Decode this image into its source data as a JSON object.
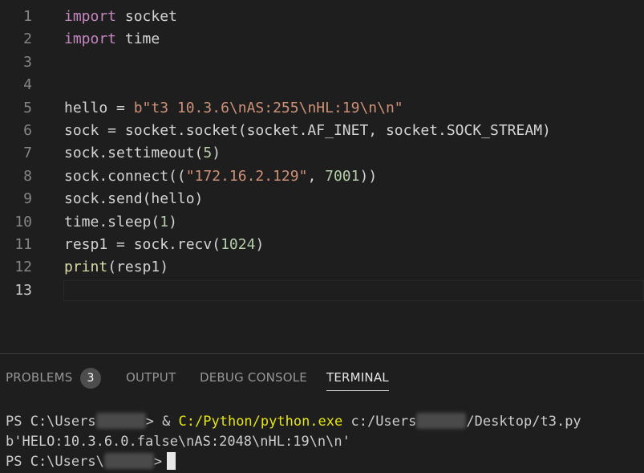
{
  "editor": {
    "line_numbers": [
      "1",
      "2",
      "3",
      "4",
      "5",
      "6",
      "7",
      "8",
      "9",
      "10",
      "11",
      "12",
      "13"
    ],
    "lines": [
      [
        {
          "t": "import",
          "c": "kw"
        },
        {
          "t": " socket",
          "c": "plain"
        }
      ],
      [
        {
          "t": "import",
          "c": "kw"
        },
        {
          "t": " time",
          "c": "plain"
        }
      ],
      [],
      [],
      [
        {
          "t": "hello = ",
          "c": "plain"
        },
        {
          "t": "b\"t3 10.3.6\\nAS:255\\nHL:19\\n\\n\"",
          "c": "str"
        }
      ],
      [
        {
          "t": "sock = socket.socket(socket.AF_INET, socket.SOCK_STREAM)",
          "c": "plain"
        }
      ],
      [
        {
          "t": "sock.settimeout(",
          "c": "plain"
        },
        {
          "t": "5",
          "c": "num"
        },
        {
          "t": ")",
          "c": "plain"
        }
      ],
      [
        {
          "t": "sock.connect((",
          "c": "plain"
        },
        {
          "t": "\"172.16.2.129\"",
          "c": "str"
        },
        {
          "t": ", ",
          "c": "plain"
        },
        {
          "t": "7001",
          "c": "num"
        },
        {
          "t": "))",
          "c": "plain"
        }
      ],
      [
        {
          "t": "sock.send(hello)",
          "c": "plain"
        }
      ],
      [
        {
          "t": "time.sleep(",
          "c": "plain"
        },
        {
          "t": "1",
          "c": "num"
        },
        {
          "t": ")",
          "c": "plain"
        }
      ],
      [
        {
          "t": "resp1 = sock.recv(",
          "c": "plain"
        },
        {
          "t": "1024",
          "c": "num"
        },
        {
          "t": ")",
          "c": "plain"
        }
      ],
      [
        {
          "t": "print",
          "c": "fn"
        },
        {
          "t": "(resp1)",
          "c": "plain"
        }
      ],
      []
    ]
  },
  "panel": {
    "tabs": {
      "problems": "PROBLEMS",
      "problems_count": "3",
      "output": "OUTPUT",
      "debug_console": "DEBUG CONSOLE",
      "terminal": "TERMINAL"
    },
    "terminal": {
      "line1_prompt": "PS C:\\Users",
      "line1_arrow": "> & ",
      "line1_exe": "C:/Python/python.exe",
      "line1_arg_a": " c:/Users",
      "line1_arg_b": "/Desktop/t3.py",
      "line2": "b'HELO:10.3.6.0.false\\nAS:2048\\nHL:19\\n\\n'",
      "line3_prompt": "PS C:\\Users\\",
      "line3_arrow": ">"
    }
  },
  "colors": {
    "background": "#1e1e1e",
    "keyword": "#c586c0",
    "string": "#ce9178",
    "number": "#b5cea8",
    "function": "#dcdcaa",
    "terminal_exe": "#e5e510"
  }
}
